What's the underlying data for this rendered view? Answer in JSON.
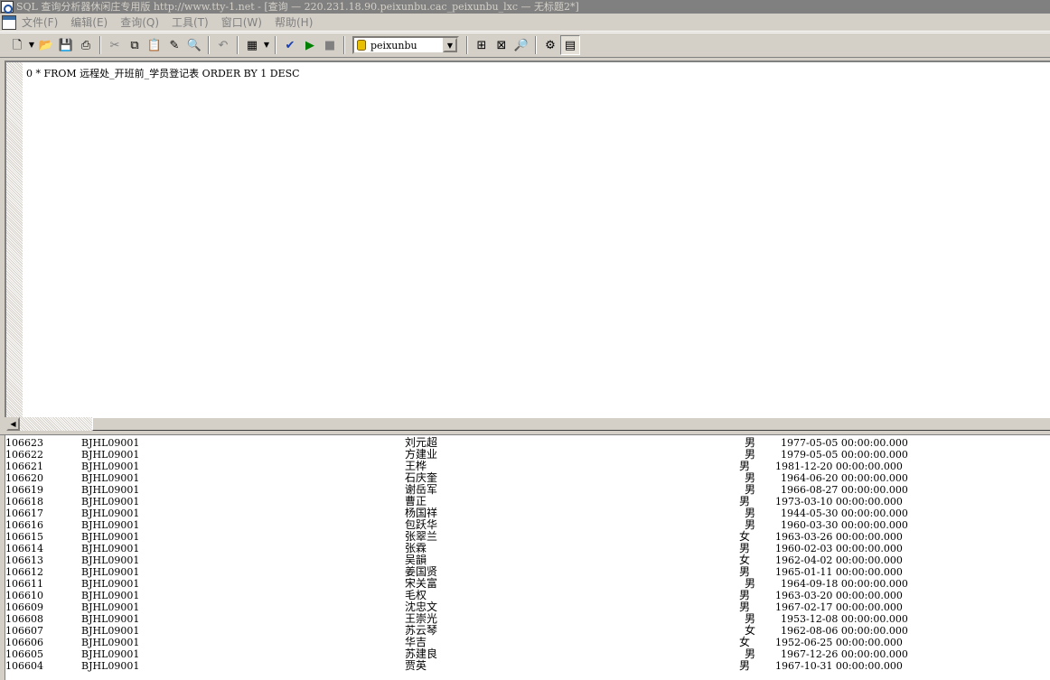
{
  "window": {
    "title": "SQL 查询分析器休闲庄专用版  http://www.tty-1.net - [查询 — 220.231.18.90.peixunbu.cac_peixunbu_lxc — 无标题2*]"
  },
  "menubar": {
    "items": [
      "文件(F)",
      "编辑(E)",
      "查询(Q)",
      "工具(T)",
      "窗口(W)",
      "帮助(H)"
    ]
  },
  "toolbar": {
    "database": "peixunbu",
    "icons": [
      "new-document-icon",
      "open-folder-icon",
      "save-icon",
      "print-icon",
      "cut-icon",
      "copy-icon",
      "paste-icon",
      "clear-icon",
      "find-icon",
      "undo-icon",
      "results-grid-icon",
      "parse-check-icon",
      "execute-icon",
      "stop-icon",
      "object-browser-icon",
      "object-search-icon",
      "display-plan-icon",
      "options-icon",
      "grid-toggle-icon"
    ]
  },
  "editor": {
    "query": "0 * FROM 远程处_开班前_学员登记表 ORDER BY 1 DESC"
  },
  "results": {
    "rows": [
      {
        "id": "106623",
        "class": "BJHL09001",
        "name": "刘元超",
        "gender": "男",
        "date": "1977-05-05 00:00:00.000"
      },
      {
        "id": "106622",
        "class": "BJHL09001",
        "name": "方建业",
        "gender": "男",
        "date": "1979-05-05 00:00:00.000"
      },
      {
        "id": "106621",
        "class": "BJHL09001",
        "name": "王桦",
        "gender": "男",
        "date": "1981-12-20 00:00:00.000"
      },
      {
        "id": "106620",
        "class": "BJHL09001",
        "name": "石庆奎",
        "gender": "男",
        "date": "1964-06-20 00:00:00.000"
      },
      {
        "id": "106619",
        "class": "BJHL09001",
        "name": "谢岳军",
        "gender": "男",
        "date": "1966-08-27 00:00:00.000"
      },
      {
        "id": "106618",
        "class": "BJHL09001",
        "name": "曹正",
        "gender": "男",
        "date": "1973-03-10 00:00:00.000"
      },
      {
        "id": "106617",
        "class": "BJHL09001",
        "name": "杨国祥",
        "gender": "男",
        "date": "1944-05-30 00:00:00.000"
      },
      {
        "id": "106616",
        "class": "BJHL09001",
        "name": "包跃华",
        "gender": "男",
        "date": "1960-03-30 00:00:00.000"
      },
      {
        "id": "106615",
        "class": "BJHL09001",
        "name": "张翠兰",
        "gender": "女",
        "date": "1963-03-26 00:00:00.000"
      },
      {
        "id": "106614",
        "class": "BJHL09001",
        "name": "张霖",
        "gender": "男",
        "date": "1960-02-03 00:00:00.000"
      },
      {
        "id": "106613",
        "class": "BJHL09001",
        "name": "吴韻",
        "gender": "女",
        "date": "1962-04-02 00:00:00.000"
      },
      {
        "id": "106612",
        "class": "BJHL09001",
        "name": "姜国贤",
        "gender": "男",
        "date": "1965-01-11 00:00:00.000"
      },
      {
        "id": "106611",
        "class": "BJHL09001",
        "name": "宋关富",
        "gender": "男",
        "date": "1964-09-18 00:00:00.000"
      },
      {
        "id": "106610",
        "class": "BJHL09001",
        "name": "毛权",
        "gender": "男",
        "date": "1963-03-20 00:00:00.000"
      },
      {
        "id": "106609",
        "class": "BJHL09001",
        "name": "沈忠文",
        "gender": "男",
        "date": "1967-02-17 00:00:00.000"
      },
      {
        "id": "106608",
        "class": "BJHL09001",
        "name": "王崇光",
        "gender": "男",
        "date": "1953-12-08 00:00:00.000"
      },
      {
        "id": "106607",
        "class": "BJHL09001",
        "name": "苏云琴",
        "gender": "女",
        "date": "1962-08-06 00:00:00.000"
      },
      {
        "id": "106606",
        "class": "BJHL09001",
        "name": "华吉",
        "gender": "女",
        "date": "1952-06-25 00:00:00.000"
      },
      {
        "id": "106605",
        "class": "BJHL09001",
        "name": "苏建良",
        "gender": "男",
        "date": "1967-12-26 00:00:00.000"
      },
      {
        "id": "106604",
        "class": "BJHL09001",
        "name": "贾英",
        "gender": "男",
        "date": "1967-10-31 00:00:00.000"
      }
    ]
  }
}
